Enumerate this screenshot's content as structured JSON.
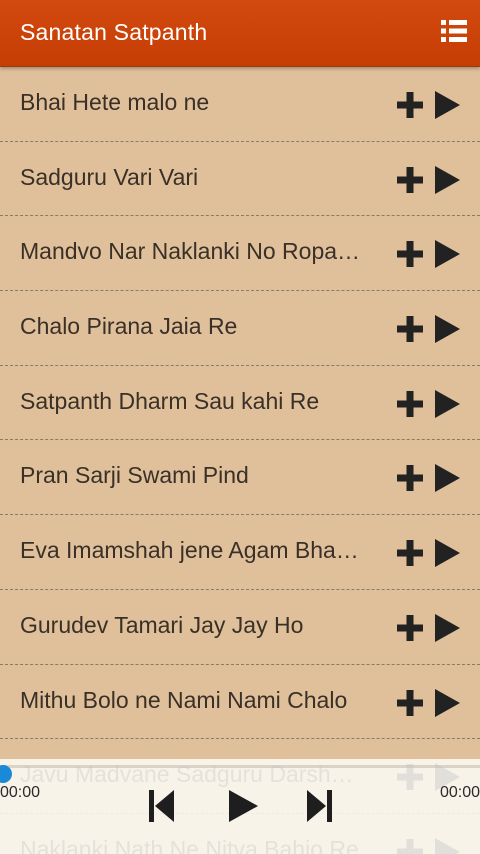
{
  "appbar": {
    "title": "Sanatan Satpanth",
    "menu_icon": "list-menu-icon",
    "background_color": "#cc4208"
  },
  "songs": [
    {
      "title": "Bhai Hete malo ne"
    },
    {
      "title": "Sadguru Vari Vari"
    },
    {
      "title": "Mandvo Nar Naklanki No Ropa…"
    },
    {
      "title": "Chalo Pirana Jaia Re"
    },
    {
      "title": "Satpanth Dharm Sau kahi Re"
    },
    {
      "title": "Pran Sarji Swami Pind"
    },
    {
      "title": "Eva Imamshah jene Agam Bha…"
    },
    {
      "title": "Gurudev Tamari Jay Jay Ho"
    },
    {
      "title": "Mithu Bolo ne Nami Nami Chalo"
    },
    {
      "title": "Javu Madvane Sadguru Darsh…"
    },
    {
      "title": "Naklanki Nath Ne Nitya Bahio Re"
    }
  ],
  "row_icons": {
    "add": "plus-icon",
    "play": "play-icon"
  },
  "player": {
    "elapsed": "00:00",
    "duration": "00:00",
    "progress": 0,
    "accent_color": "#1a8ad8"
  }
}
